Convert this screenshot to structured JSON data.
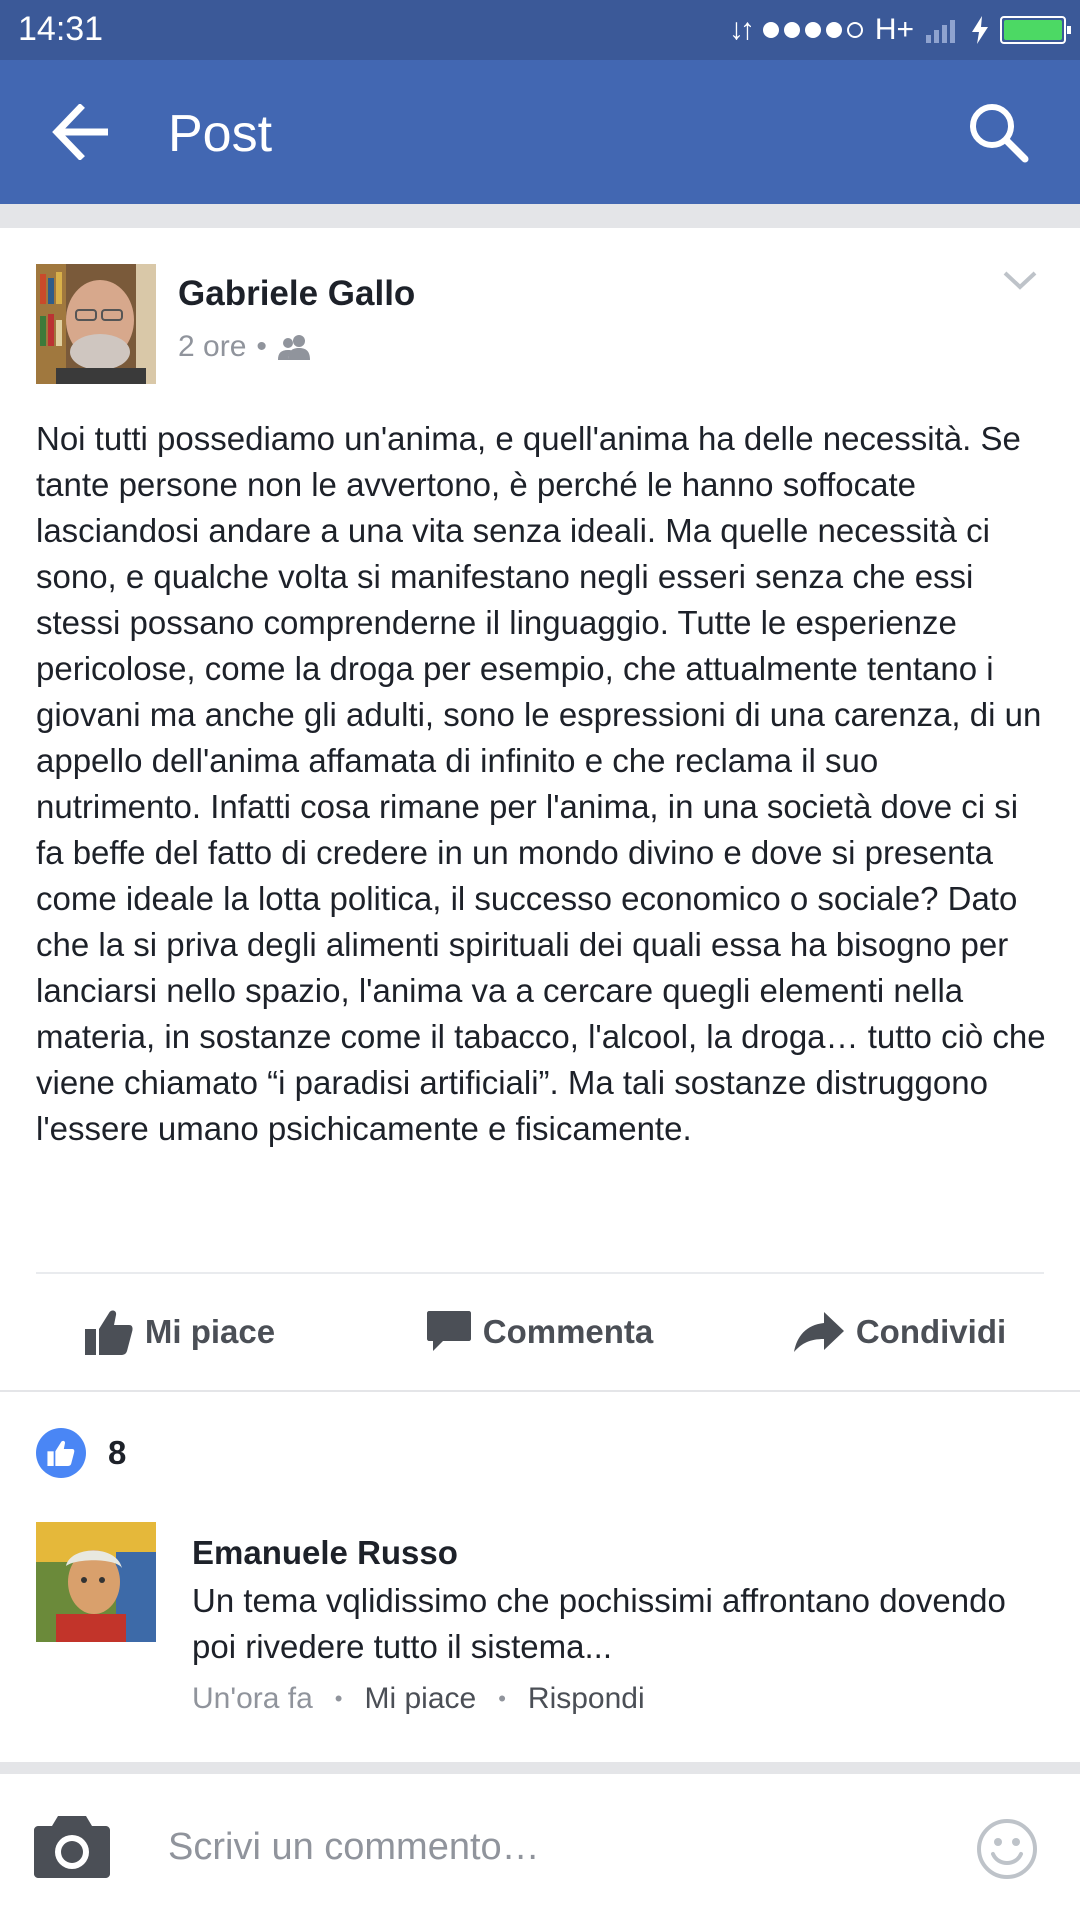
{
  "status_bar": {
    "time": "14:31",
    "network": "H+",
    "signal_dots_filled": 4,
    "signal_dots_total": 5,
    "battery_level": 1.0,
    "battery_color": "#4cd964"
  },
  "app_bar": {
    "title": "Post",
    "back_icon": "arrow-left-icon",
    "search_icon": "search-icon",
    "color": "#4267b2"
  },
  "post": {
    "author": "Gabriele Gallo",
    "time": "2 ore",
    "audience_icon": "friends-icon",
    "text": "Noi tutti possediamo un'anima, e quell'anima ha delle necessità. Se tante persone non le avvertono, è perché le hanno soffocate lasciandosi andare a una vita senza ideali. Ma quelle necessità ci sono, e qualche volta si manifestano negli esseri senza che essi stessi possano comprenderne il linguaggio. Tutte le esperienze pericolose, come la droga per esempio, che attualmente tentano i giovani ma anche gli adulti, sono le espressioni di una carenza, di un appello dell'anima affamata di infinito e che reclama il suo nutrimento. Infatti cosa rimane per l'anima, in una società dove ci si fa beffe del fatto di credere in un mondo divino e dove si presenta come ideale la lotta politica, il successo economico o sociale? Dato che la si priva degli alimenti spirituali dei quali essa ha bisogno per lanciarsi nello spazio, l'anima va a cercare quegli elementi nella materia, in sostanze come il tabacco, l'alcool, la droga… tutto ciò che viene chiamato “i paradisi artificiali”. Ma tali sostanze distruggono l'essere umano psichicamente e fisicamente."
  },
  "actions": {
    "like": "Mi piace",
    "comment": "Commenta",
    "share": "Condividi"
  },
  "likes": {
    "count": "8",
    "badge_color": "#4a86f5"
  },
  "comment": {
    "author": "Emanuele Russo",
    "text": "Un tema vqlidissimo che pochissimi affrontano dovendo poi rivedere tutto il sistema...",
    "time": "Un'ora fa",
    "like": "Mi piace",
    "reply": "Rispondi"
  },
  "composer": {
    "placeholder": "Scrivi un commento…",
    "camera_icon": "camera-icon",
    "emoji_icon": "emoji-icon"
  }
}
